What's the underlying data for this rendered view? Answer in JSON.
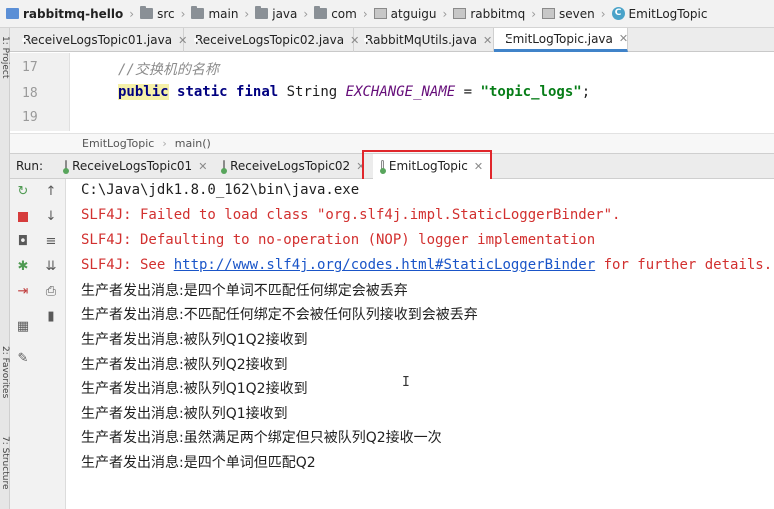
{
  "breadcrumb": {
    "project": "rabbitmq-hello",
    "items": [
      "src",
      "main",
      "java",
      "com",
      "atguigu",
      "rabbitmq",
      "seven",
      "EmitLogTopic"
    ]
  },
  "editor_tabs": [
    {
      "label": "ReceiveLogsTopic01.java",
      "active": false
    },
    {
      "label": "ReceiveLogsTopic02.java",
      "active": false
    },
    {
      "label": "RabbitMqUtils.java",
      "active": false
    },
    {
      "label": "EmitLogTopic.java",
      "active": true
    }
  ],
  "editor": {
    "line_numbers": [
      "17",
      "18",
      "19"
    ],
    "comment": "//交换机的名称",
    "code": {
      "kw_public": "public",
      "kw_static": "static",
      "kw_final": "final",
      "type": "String",
      "const_name": "EXCHANGE_NAME",
      "equals": "=",
      "string_value": "\"topic_logs\"",
      "semicolon": ";"
    },
    "breadcrumb": {
      "class": "EmitLogTopic",
      "method": "main()"
    }
  },
  "run_window": {
    "label": "Run:",
    "tabs": [
      {
        "label": "ReceiveLogsTopic01",
        "active": false
      },
      {
        "label": "ReceiveLogsTopic02",
        "active": false
      },
      {
        "label": "EmitLogTopic",
        "active": true
      }
    ]
  },
  "side_strip": {
    "project_label": "1: Project",
    "favorites_label": "2: Favorites",
    "structure_label": "7: Structure"
  },
  "console": {
    "java_path": "C:\\Java\\jdk1.8.0_162\\bin\\java.exe",
    "slf4j_line1": "SLF4J: Failed to load class \"org.slf4j.impl.StaticLoggerBinder\".",
    "slf4j_line2": "SLF4J: Defaulting to no-operation (NOP) logger implementation",
    "slf4j_line3_prefix": "SLF4J: See ",
    "slf4j_line3_link": "http://www.slf4j.org/codes.html#StaticLoggerBinder",
    "slf4j_line3_suffix": " for further details.",
    "messages": [
      "生产者发出消息:是四个单词不匹配任何绑定会被丢弃",
      "生产者发出消息:不匹配任何绑定不会被任何队列接收到会被丢弃",
      "生产者发出消息:被队列Q1Q2接收到",
      "生产者发出消息:被队列Q2接收到",
      "生产者发出消息:被队列Q1Q2接收到",
      "生产者发出消息:被队列Q1接收到",
      "生产者发出消息:虽然满足两个绑定但只被队列Q2接收一次",
      "生产者发出消息:是四个单词但匹配Q2"
    ]
  },
  "colors": {
    "highlight_box": "#e0262b",
    "error_text": "#d2302f",
    "link_text": "#1a55c8",
    "active_tab_underline": "#4083c9"
  }
}
